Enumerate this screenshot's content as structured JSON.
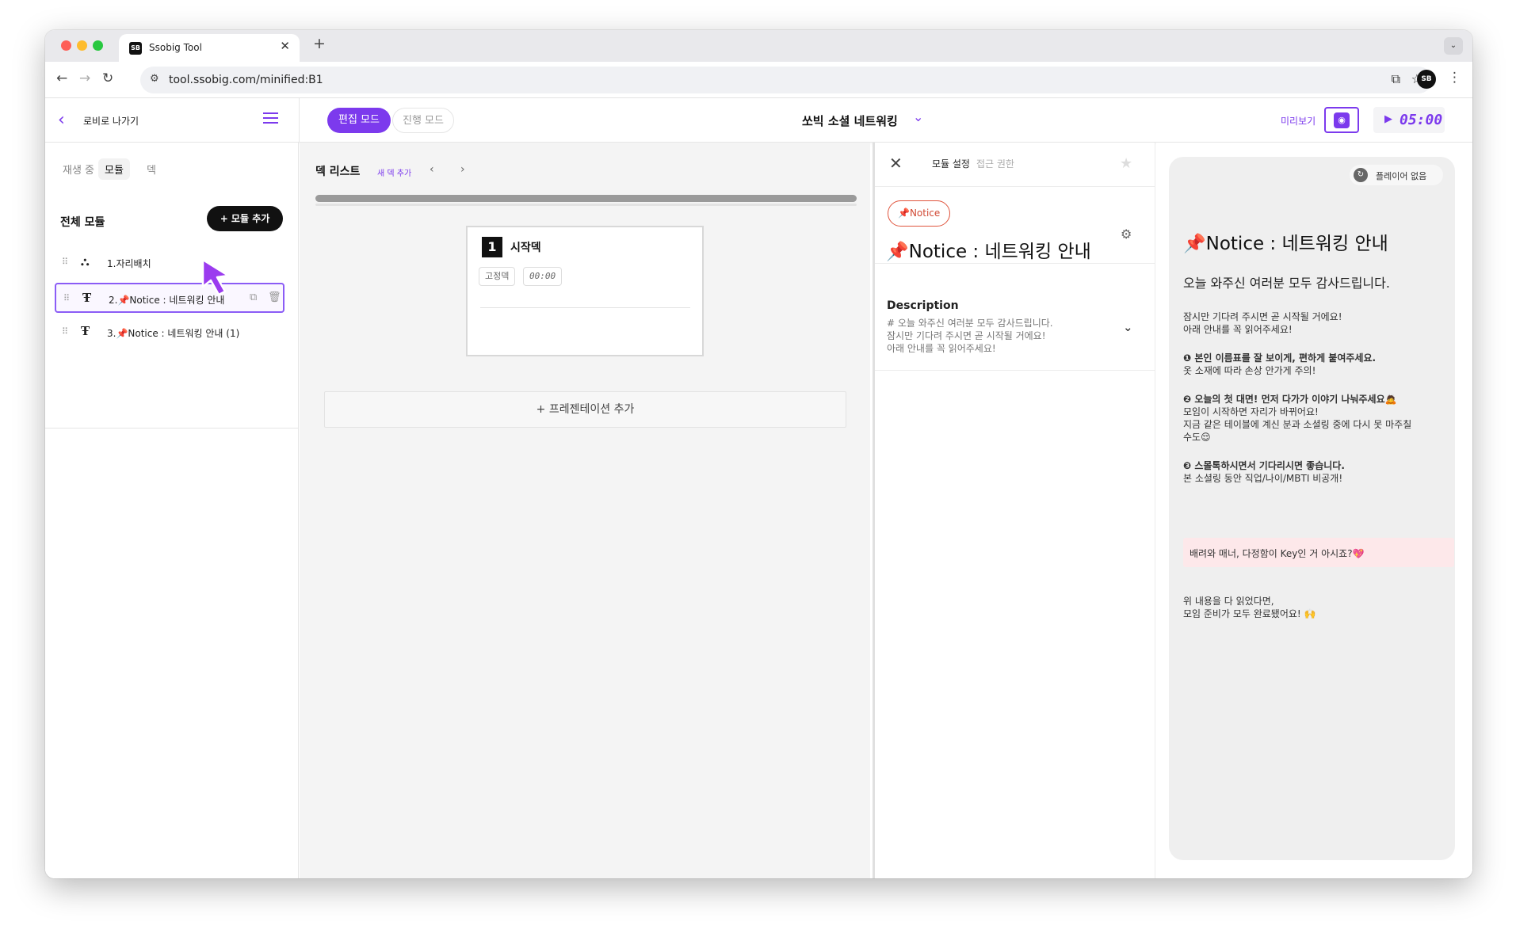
{
  "browser": {
    "tab_title": "Ssobig Tool",
    "url": "tool.ssobig.com/minified:B1",
    "favicon_text": "SB"
  },
  "header": {
    "back_label": "로비로 나가기",
    "edit_mode": "편집 모드",
    "run_mode": "진행 모드",
    "session_title": "쏘빅 소셜 네트워킹",
    "preview_label": "미리보기",
    "timer": "05:00"
  },
  "left": {
    "tabs": [
      "재생 중",
      "모듈",
      "덱"
    ],
    "section_title": "전체 모듈",
    "add_module": "+ 모듈 추가",
    "modules": [
      {
        "label": "1.자리배치",
        "icon": "seat-arrange-icon"
      },
      {
        "label": "2.📌Notice : 네트워킹 안내",
        "icon": "text-icon",
        "selected": true
      },
      {
        "label": "3.📌Notice : 네트워킹 안내 (1)",
        "icon": "text-icon"
      }
    ]
  },
  "center": {
    "deck_list": "덱 리스트",
    "new_deck": "새 덱 추가",
    "card": {
      "number": "1",
      "title": "시작덱",
      "fixed_label": "고정덱",
      "time": "00:00"
    },
    "add_presentation": "+  프레젠테이션 추가"
  },
  "settings": {
    "tab_module": "모듈 설정",
    "tab_access": "접근 권한",
    "tag": "📌Notice",
    "title": "📌Notice : 네트워킹 안내",
    "description_heading": "Description",
    "description_lines": [
      "# 오늘 와주신 여러분 모두 감사드립니다.",
      "잠시만 기다려 주시면 곧 시작될 거에요!",
      "아래 안내를 꼭 읽어주세요!"
    ]
  },
  "preview": {
    "no_player": "플레이어 없음",
    "title": "📌Notice : 네트워킹 안내",
    "subtitle": "오늘 와주신 여러분 모두 감사드립니다.",
    "intro": [
      "잠시만 기다려 주시면 곧 시작될 거에요!",
      "아래 안내를 꼭 읽어주세요!"
    ],
    "point1_title": "❶ 본인 이름표를 잘 보이게, 편하게 붙여주세요.",
    "point1_body": "옷 소재에 따라 손상 안가게 주의!",
    "point2_title": "❷ 오늘의 첫 대면! 먼저 다가가 이야기 나눠주세요🙇",
    "point2_body": [
      "모임이 시작하면 자리가 바뀌어요!",
      "지금 같은 테이블에 계신 분과 소셜링 중에 다시 못 마주칠",
      "수도😌"
    ],
    "point3_title": "❸ 스몰톡하시면서 기다리시면 좋습니다.",
    "point3_body": "본 소셜링 동안 직업/나이/MBTI 비공개!",
    "highlight": "배려와 매너, 다정함이 Key인 거 아시죠?💖",
    "outro": [
      "위 내용을 다 읽었다면,",
      "모임 준비가 모두 완료됐어요! 🙌"
    ]
  },
  "colors": {
    "accent": "#7c3aed",
    "tag": "#d14a35",
    "highlight_bg": "#fde8ea"
  }
}
